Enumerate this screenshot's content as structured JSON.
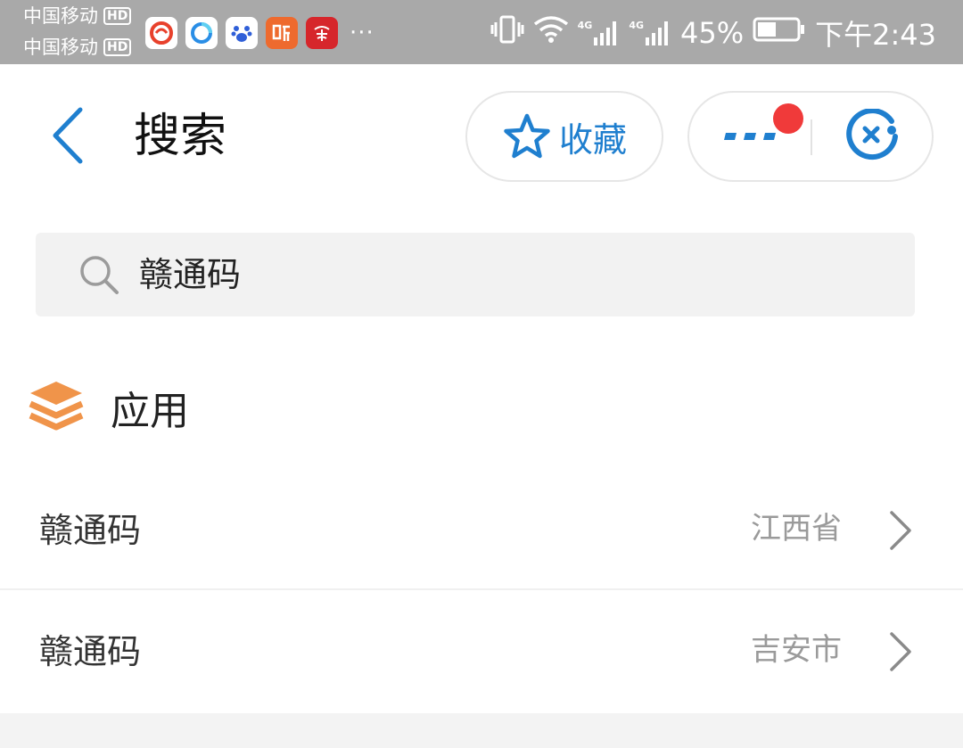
{
  "status_bar": {
    "carrier1": "中国移动",
    "carrier2": "中国移动",
    "hd_badge": "HD",
    "notif_more": "···",
    "net1": "4G",
    "net2": "4G",
    "battery_pct": "45%",
    "time": "下午2:43",
    "app_icons": [
      "ifeng-icon",
      "qq-browser-icon",
      "baidu-icon",
      "ting-icon",
      "xuexi-icon"
    ]
  },
  "header": {
    "title": "搜索",
    "favorite_label": "收藏"
  },
  "search": {
    "query": "赣通码"
  },
  "section": {
    "title": "应用"
  },
  "results": [
    {
      "name": "赣通码",
      "region": "江西省"
    },
    {
      "name": "赣通码",
      "region": "吉安市"
    }
  ],
  "colors": {
    "accent_blue": "#1f7fcf",
    "section_icon_orange": "#f0944a",
    "badge_red": "#f03a3a",
    "status_bar_bg": "#a9a9a9"
  }
}
